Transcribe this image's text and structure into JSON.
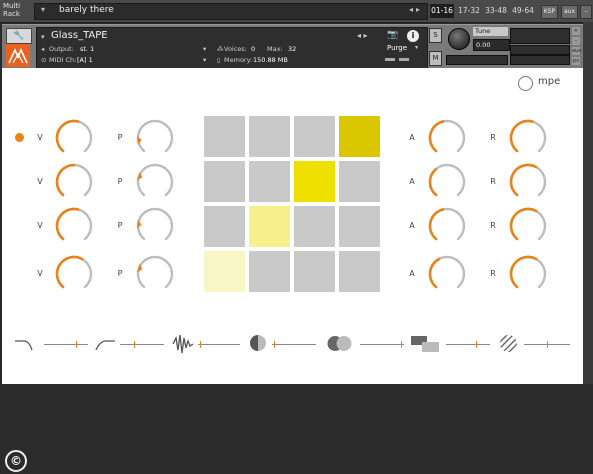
{
  "top_bar": {
    "multi_rack_label": "Multi\nRack",
    "rack_name": "barely there",
    "pages": [
      "01-16",
      "17-32",
      "33-48",
      "49-64"
    ],
    "selected_page": "01-16",
    "ksp_label": "KSP",
    "aux_label": "aux"
  },
  "instrument": {
    "name": "Glass_TAPE",
    "output_label": "Output:",
    "output_value": "st. 1",
    "voices_label": "Voices:",
    "voices_value": "0",
    "max_label": "Max:",
    "max_value": "32",
    "purge_label": "Purge",
    "midi_label": "MIDI Ch:",
    "midi_value": "[A] 1",
    "memory_label": "Memory:",
    "memory_value": "150.88 MB",
    "solo_label": "S",
    "mute_label": "M",
    "tune_label": "Tune",
    "tune_value": "0.00",
    "info_icon": "i"
  },
  "panel": {
    "mpe_label": "mpe",
    "left_labels": {
      "v": "V",
      "p": "P"
    },
    "right_labels": {
      "a": "A",
      "r": "R"
    },
    "v_knob_levels": [
      0.55,
      0.5,
      0.55,
      0.6
    ],
    "p_knob_levels": [
      0.15,
      0.25,
      0.2,
      0.25
    ],
    "a_knob_levels": [
      0.45,
      0.35,
      0.45,
      0.4
    ],
    "r_knob_levels": [
      0.55,
      0.6,
      0.6,
      0.6
    ],
    "pads": [
      [
        "#c9c9c9",
        "#c9c9c9",
        "#c9c9c9",
        "#d9c800"
      ],
      [
        "#c9c9c9",
        "#c9c9c9",
        "#f0e000",
        "#c9c9c9"
      ],
      [
        "#c9c9c9",
        "#f8f08c",
        "#c9c9c9",
        "#c9c9c9"
      ],
      [
        "#faf5c4",
        "#c9c9c9",
        "#c9c9c9",
        "#c9c9c9"
      ]
    ],
    "fx_icons": [
      "lowpass-filter-icon",
      "highpass-filter-icon",
      "waveform-icon",
      "half-moon-icon",
      "overlap-circles-icon",
      "stacked-rectangles-icon",
      "striped-circle-icon"
    ],
    "accent_color": "#e8841a"
  },
  "footer": {
    "copyright_symbol": "©"
  }
}
